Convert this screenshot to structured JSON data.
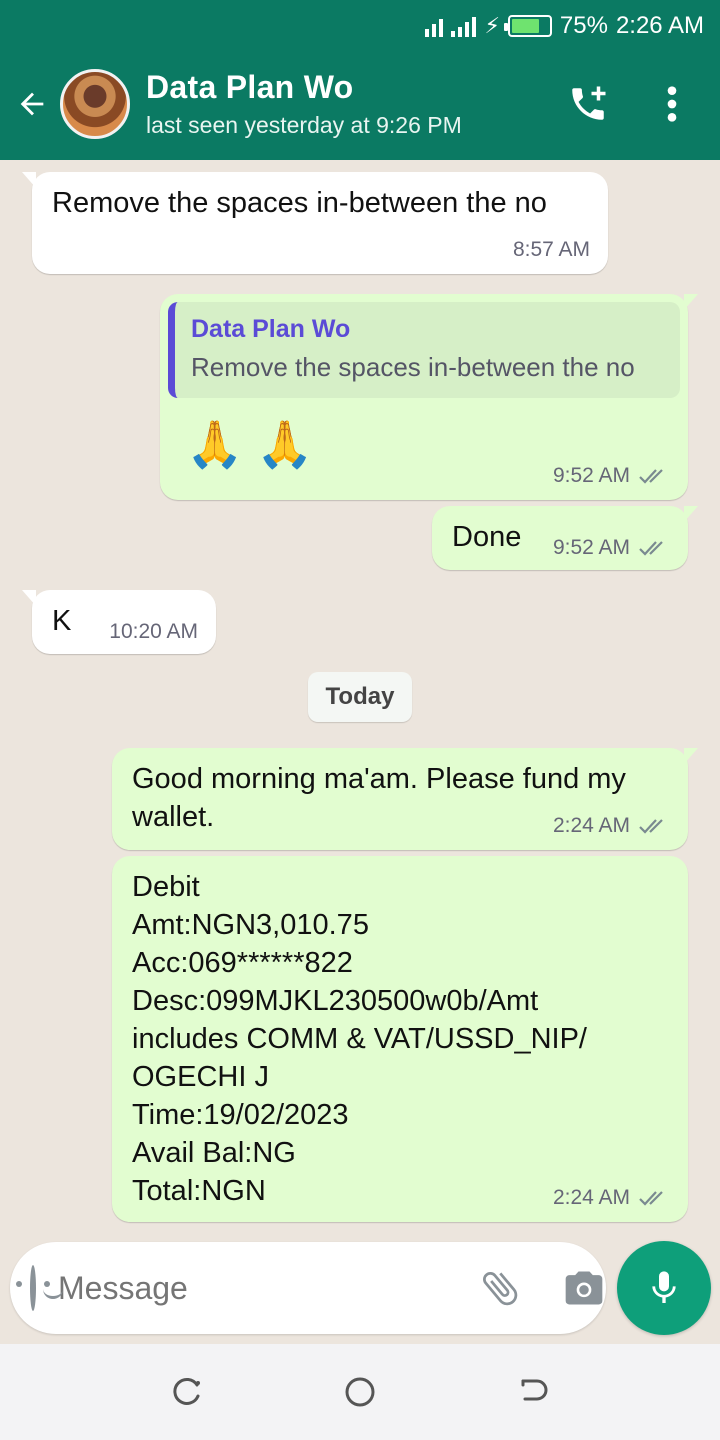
{
  "status_bar": {
    "battery_percent": "75%",
    "time": "2:26 AM",
    "battery_level": 0.75
  },
  "header": {
    "contact_name": "Data Plan Wo",
    "last_seen": "last seen yesterday at 9:26 PM"
  },
  "messages": [
    {
      "direction": "in",
      "text": "Remove the spaces in-between the no",
      "time": "8:57 AM"
    },
    {
      "direction": "out",
      "reply_to_name": "Data Plan Wo",
      "reply_to_text": "Remove the spaces in-between the no",
      "text": "🙏 🙏",
      "time": "9:52 AM",
      "status": "read"
    },
    {
      "direction": "out",
      "text": "Done",
      "time": "9:52 AM",
      "status": "read"
    },
    {
      "direction": "in",
      "text": "K",
      "time": "10:20 AM"
    },
    {
      "direction": "out",
      "text": "Good morning ma'am. Please fund my wallet.",
      "time": "2:24 AM",
      "status": "read"
    },
    {
      "direction": "out",
      "lines": [
        "Debit",
        "Amt:NGN3,010.75",
        "Acc:069******822",
        "Desc:099MJKL230500w0b/Amt",
        "includes COMM & VAT/USSD_NIP/",
        "OGECHI J",
        "Time:19/02/2023",
        "Avail Bal:NG",
        "Total:NGN"
      ],
      "time": "2:24 AM",
      "status": "read"
    }
  ],
  "day_separator": "Today",
  "composer": {
    "placeholder": "Message"
  },
  "colors": {
    "header": "#0b7a63",
    "outgoing_bubble": "#e2fdd0",
    "incoming_bubble": "#ffffff",
    "mic_button": "#0e9f7a",
    "quote_accent": "#5b4bd6"
  },
  "icons": [
    "back-arrow-icon",
    "add-call-icon",
    "more-vert-icon",
    "emoji-icon",
    "attach-icon",
    "camera-icon",
    "mic-icon",
    "recents-icon",
    "home-icon",
    "back-nav-icon"
  ]
}
